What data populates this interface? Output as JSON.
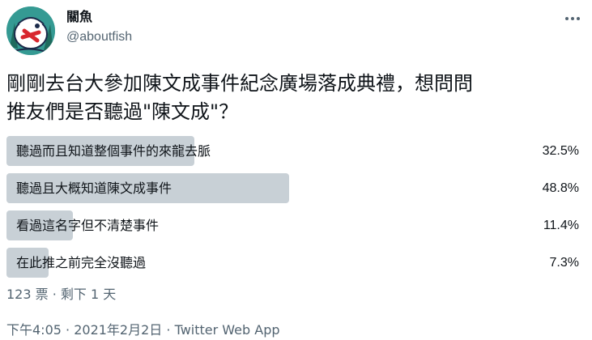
{
  "author": {
    "display_name": "關魚",
    "handle": "@aboutfish"
  },
  "tweet": {
    "text": "剛剛去台大參加陳文成事件紀念廣場落成典禮，想問問\n推友們是否聽過\"陳文成\"？"
  },
  "poll": {
    "options": [
      {
        "label": "聽過而且知道整個事件的來龍去脈",
        "percent_text": "32.5%",
        "percent": 32.5
      },
      {
        "label": "聽過且大概知道陳文成事件",
        "percent_text": "48.8%",
        "percent": 48.8
      },
      {
        "label": "看過這名字但不清楚事件",
        "percent_text": "11.4%",
        "percent": 11.4
      },
      {
        "label": "在此推之前完全沒聽過",
        "percent_text": "7.3%",
        "percent": 7.3
      }
    ],
    "votes": "123 票",
    "separator": " · ",
    "remaining": "剩下 1 天"
  },
  "timestamp": {
    "time": "下午4:05",
    "separator1": " · ",
    "date": "2021年2月2日",
    "separator2": " · ",
    "source": "Twitter Web App"
  },
  "colors": {
    "poll_bar": "#c8d0d6",
    "secondary_text": "#536471",
    "primary_text": "#0f1419"
  },
  "icons": {
    "more": "more-horizontal-icon",
    "avatar": "fish-cartoon-avatar"
  }
}
